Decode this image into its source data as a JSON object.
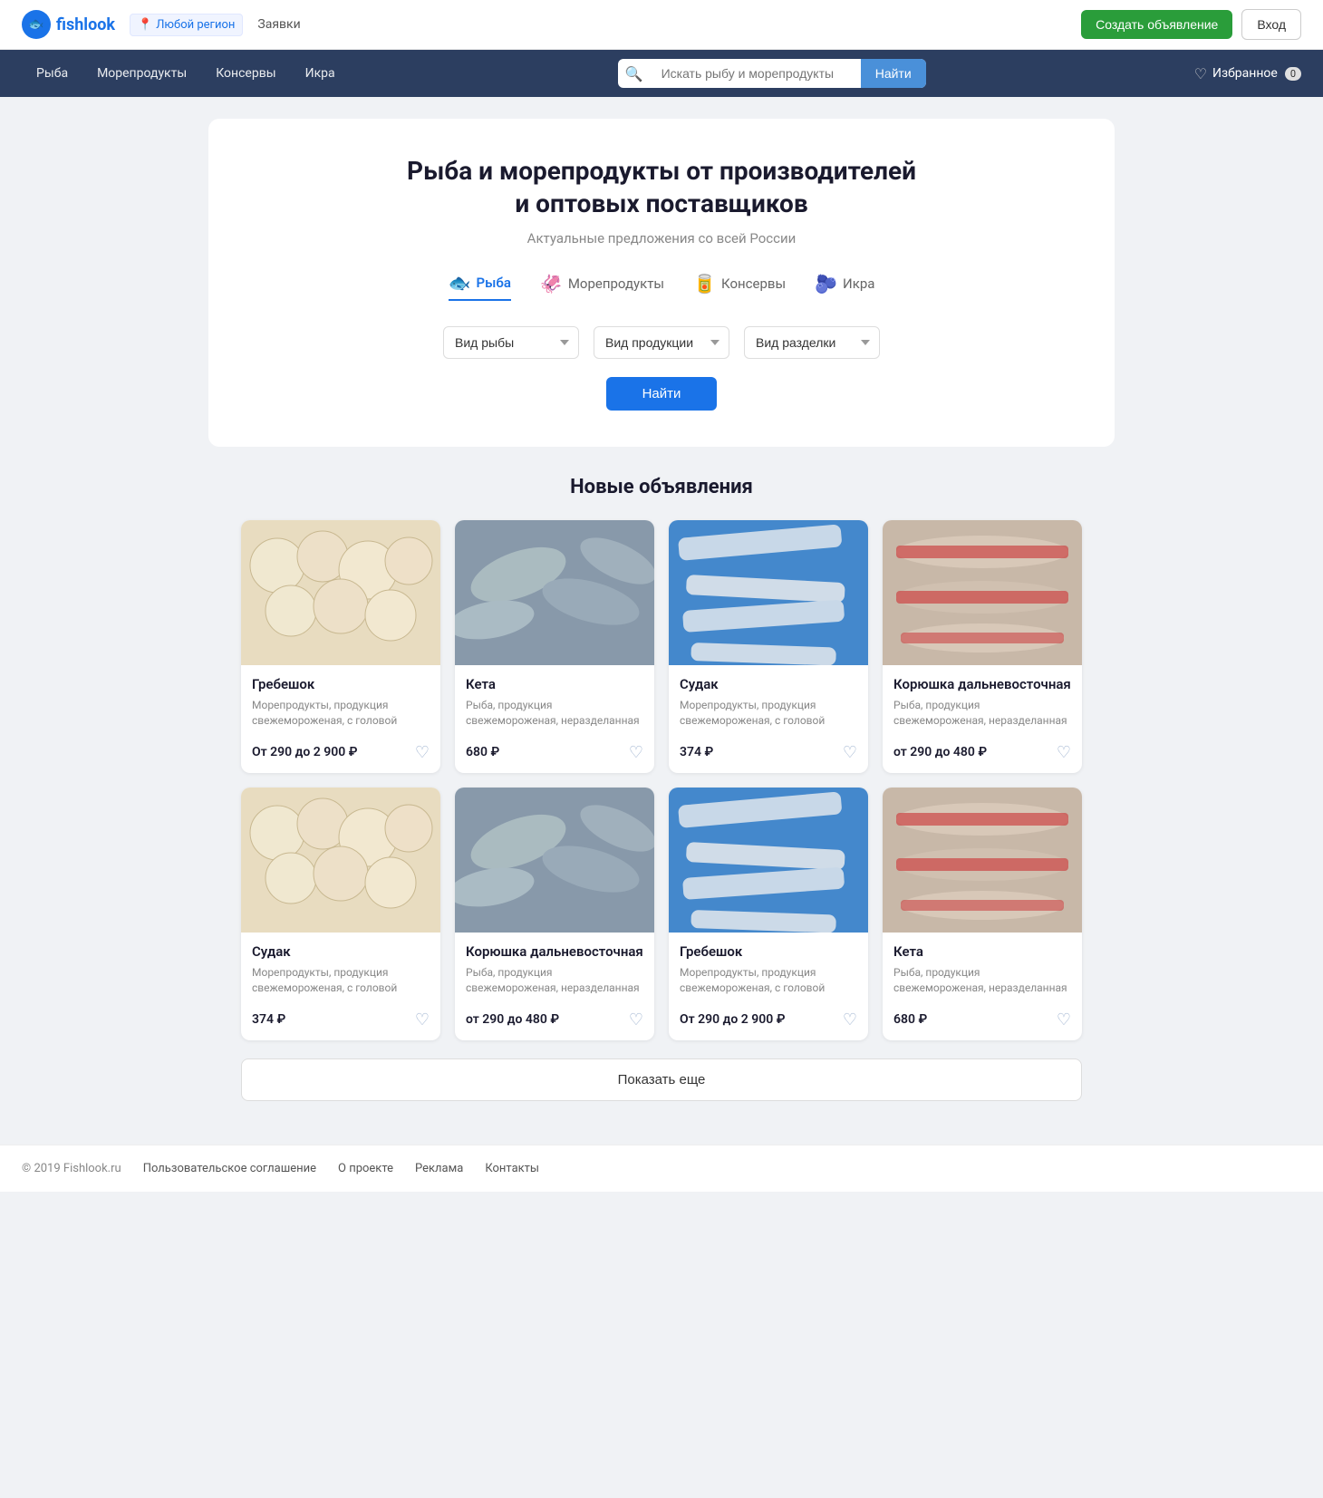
{
  "logo": {
    "icon": "🐟",
    "name": "fishlook"
  },
  "topbar": {
    "region_label": "Любой регион",
    "nav_label": "Заявки",
    "create_label": "Создать объявление",
    "login_label": "Вход"
  },
  "navbar": {
    "items": [
      "Рыба",
      "Морепродукты",
      "Консервы",
      "Икра"
    ],
    "search_placeholder": "Искать рыбу и морепродукты",
    "search_btn": "Найти",
    "favorites_label": "Избранное",
    "favorites_count": "0"
  },
  "hero": {
    "title": "Рыба и морепродукты от  производителей\nи оптовых поставщиков",
    "subtitle": "Актуальные предложения со всей России",
    "tabs": [
      {
        "label": "Рыба",
        "icon": "🐟",
        "active": true
      },
      {
        "label": "Морепродукты",
        "icon": "🦑",
        "active": false
      },
      {
        "label": "Консервы",
        "icon": "🥫",
        "active": false
      },
      {
        "label": "Икра",
        "icon": "🫐",
        "active": false
      }
    ],
    "filters": [
      {
        "label": "Вид рыбы",
        "id": "fish-type"
      },
      {
        "label": "Вид продукции",
        "id": "product-type"
      },
      {
        "label": "Вид разделки",
        "id": "cut-type"
      }
    ],
    "search_btn": "Найти"
  },
  "listings": {
    "title": "Новые объявления",
    "cards": [
      {
        "id": 1,
        "title": "Гребешок",
        "desc": "Морепродукты, продукция свежемороженая, с головой",
        "price": "От 290 до 2 900 ₽",
        "color": "#f5e6c0",
        "emoji": "🐚"
      },
      {
        "id": 2,
        "title": "Кета",
        "desc": "Рыба, продукция свежемороженая, неразделанная",
        "price": "680 ₽",
        "color": "#c8d4c0",
        "emoji": "🐟"
      },
      {
        "id": 3,
        "title": "Судак",
        "desc": "Морепродукты, продукция свежемороженая, с головой",
        "price": "374 ₽",
        "color": "#c0d5e8",
        "emoji": "🐡"
      },
      {
        "id": 4,
        "title": "Корюшка дальневосточная",
        "desc": "Рыба, продукция свежемороженая, неразделанная",
        "price": "от 290 до 480 ₽",
        "color": "#d8c8c0",
        "emoji": "🐠"
      },
      {
        "id": 5,
        "title": "Судак",
        "desc": "Морепродукты, продукция свежемороженая, с головой",
        "price": "374 ₽",
        "color": "#c0d5e8",
        "emoji": "🐡"
      },
      {
        "id": 6,
        "title": "Корюшка дальневосточная",
        "desc": "Рыба, продукция свежемороженая, неразделанная",
        "price": "от 290 до 480 ₽",
        "color": "#d8c8c0",
        "emoji": "🐠"
      },
      {
        "id": 7,
        "title": "Гребешок",
        "desc": "Морепродукты, продукция свежемороженая, с головой",
        "price": "От 290 до 2 900 ₽",
        "color": "#f5e6c0",
        "emoji": "🐚"
      },
      {
        "id": 8,
        "title": "Кета",
        "desc": "Рыба, продукция свежемороженая, неразделанная",
        "price": "680 ₽",
        "color": "#c8d4c0",
        "emoji": "🐟"
      }
    ]
  },
  "show_more_btn": "Показать еще",
  "footer": {
    "copyright": "© 2019 Fishlook.ru",
    "links": [
      "Пользовательское соглашение",
      "О проекте",
      "Реклама",
      "Контакты"
    ]
  }
}
